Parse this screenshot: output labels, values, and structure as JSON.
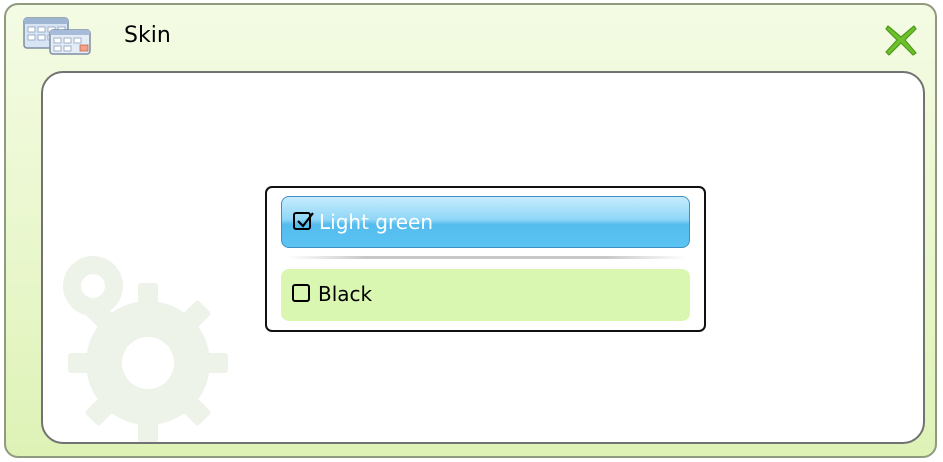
{
  "window": {
    "title": "Skin",
    "icon": "calendar-grid-icon",
    "close_icon": "close-x-icon"
  },
  "skin_options": [
    {
      "label": "Light green",
      "checked": true,
      "selected": true
    },
    {
      "label": "Black",
      "checked": false,
      "selected": false
    }
  ],
  "colors": {
    "window_background": "#e9f7cc",
    "selected_option": "#5cc4f3",
    "plain_option": "#daf7b1",
    "close_x": "#6dc02c"
  }
}
